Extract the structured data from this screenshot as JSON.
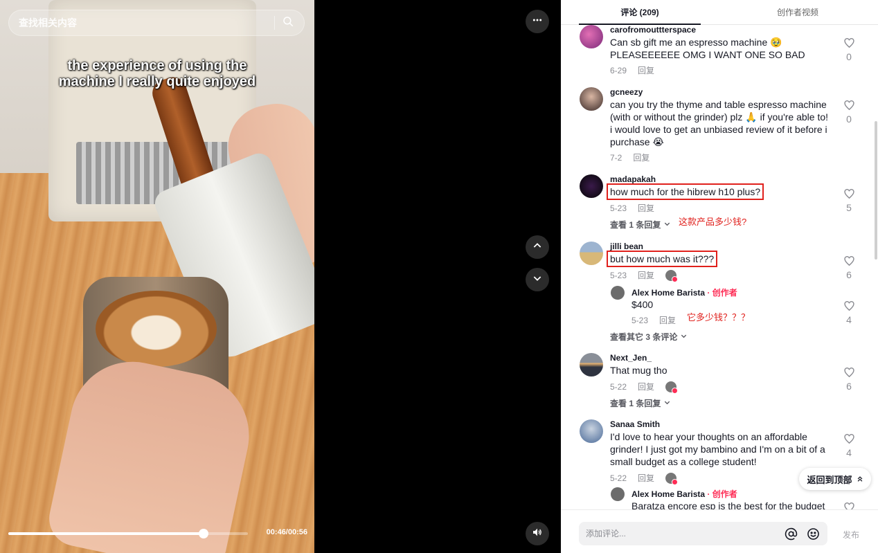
{
  "video": {
    "search_placeholder": "查找相关内容",
    "caption_line1": "the experience of using the",
    "caption_line2": "machine I really quite enjoyed",
    "progress": 0.815,
    "time": "00:46/00:56"
  },
  "tabs": [
    {
      "label": "评论 (209)",
      "active": true
    },
    {
      "label": "创作者视频",
      "active": false
    }
  ],
  "comments": [
    {
      "user": "carofromouttterspace",
      "text": "Can sb gift me an espresso machine 🥹 PLEASEEEEEE OMG I WANT ONE SO BAD",
      "date": "6-29",
      "reply": "回复",
      "likes": "0"
    },
    {
      "user": "gcneezy",
      "text": "can you try the thyme and table espresso machine (with or without the grinder) plz 🙏 if you're able to! i would love to get an unbiased review of it before i purchase 😭",
      "date": "7-2",
      "reply": "回复",
      "likes": "0"
    },
    {
      "user": "madapakah",
      "text": "how much for the hibrew h10 plus?",
      "date": "5-23",
      "reply": "回复",
      "likes": "5",
      "more": "查看 1 条回复",
      "annotation": "这款产品多少钱?"
    },
    {
      "user": "jilli bean",
      "text": "but how much was it???",
      "date": "5-23",
      "reply": "回复",
      "likes": "6",
      "sub": {
        "user": "Alex Home Barista",
        "creator_tag": "· 创作者",
        "text": "$400",
        "date": "5-23",
        "reply": "回复",
        "likes": "4",
        "annotation": "它多少钱？？？"
      },
      "more": "查看其它 3 条评论"
    },
    {
      "user": "Next_Jen_",
      "text": "That mug tho",
      "date": "5-22",
      "reply": "回复",
      "likes": "6",
      "more": "查看 1 条回复"
    },
    {
      "user": "Sanaa Smith",
      "text": "I'd love to hear your thoughts on an affordable grinder! I just got my bambino and I'm on a bit of a small budget as a college student!",
      "date": "5-22",
      "reply": "回复",
      "likes": "4",
      "sub": {
        "user": "Alex Home Barista",
        "creator_tag": "· 创作者",
        "text": "Baratza encore esp is the best for the budget"
      }
    }
  ],
  "back_to_top": "返回到顶部",
  "input": {
    "placeholder": "添加评论...",
    "post": "发布"
  },
  "colors": {
    "accent": "#fe2c55",
    "annotation": "#e0201c"
  }
}
